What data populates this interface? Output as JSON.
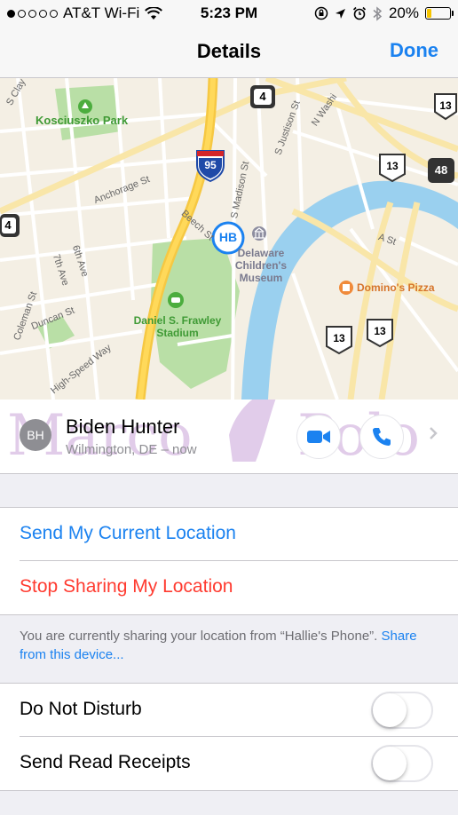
{
  "status_bar": {
    "carrier": "AT&T Wi-Fi",
    "time": "5:23 PM",
    "battery": "20%",
    "battery_level": 0.2,
    "signal_bars": 1,
    "icons": [
      "wifi-icon",
      "lock-rotation-icon",
      "location-arrow-icon",
      "alarm-icon",
      "bluetooth-icon",
      "battery-icon"
    ]
  },
  "nav": {
    "title": "Details",
    "done_label": "Done"
  },
  "map": {
    "labels": {
      "kosciuszko_park": "Kosciuszko Park",
      "anchorage_st": "Anchorage St",
      "beech_st": "Beech St",
      "madison_st": "S Madison St",
      "justison_st": "S Justison St",
      "n_washington": "N Washi",
      "sixth_ave": "6th Ave",
      "seventh_ave": "7th Ave",
      "coleman_st": "Coleman St",
      "duncan_st": "Duncan St",
      "high_speed_way": "High-Speed Way",
      "s_clay": "S Clay",
      "a_st": "A St",
      "museum": "Delaware Children's Museum",
      "stadium": "Daniel S. Frawley Stadium",
      "dominos": "Domino's Pizza"
    },
    "shields": {
      "interstate": "95",
      "route_4": "4",
      "route_13": "13",
      "route_48": "48"
    },
    "pin_initials": "HB",
    "pin_color": "#1b82f0"
  },
  "contact": {
    "initials": "BH",
    "name": "Biden Hunter",
    "subtitle": "Wilmington, DE – now",
    "watermark": "Marco Polo"
  },
  "actions": {
    "send_location": "Send My Current Location",
    "stop_sharing": "Stop Sharing My Location"
  },
  "footer": {
    "text": "You are currently sharing your location from “Hallie's Phone”.",
    "link": "Share from this device..."
  },
  "settings": {
    "dnd_label": "Do Not Disturb",
    "dnd_on": false,
    "read_receipts_label": "Send Read Receipts",
    "read_receipts_on": false
  },
  "colors": {
    "accent": "#1b82f0",
    "destructive": "#ff3b30",
    "background": "#efeff4"
  }
}
